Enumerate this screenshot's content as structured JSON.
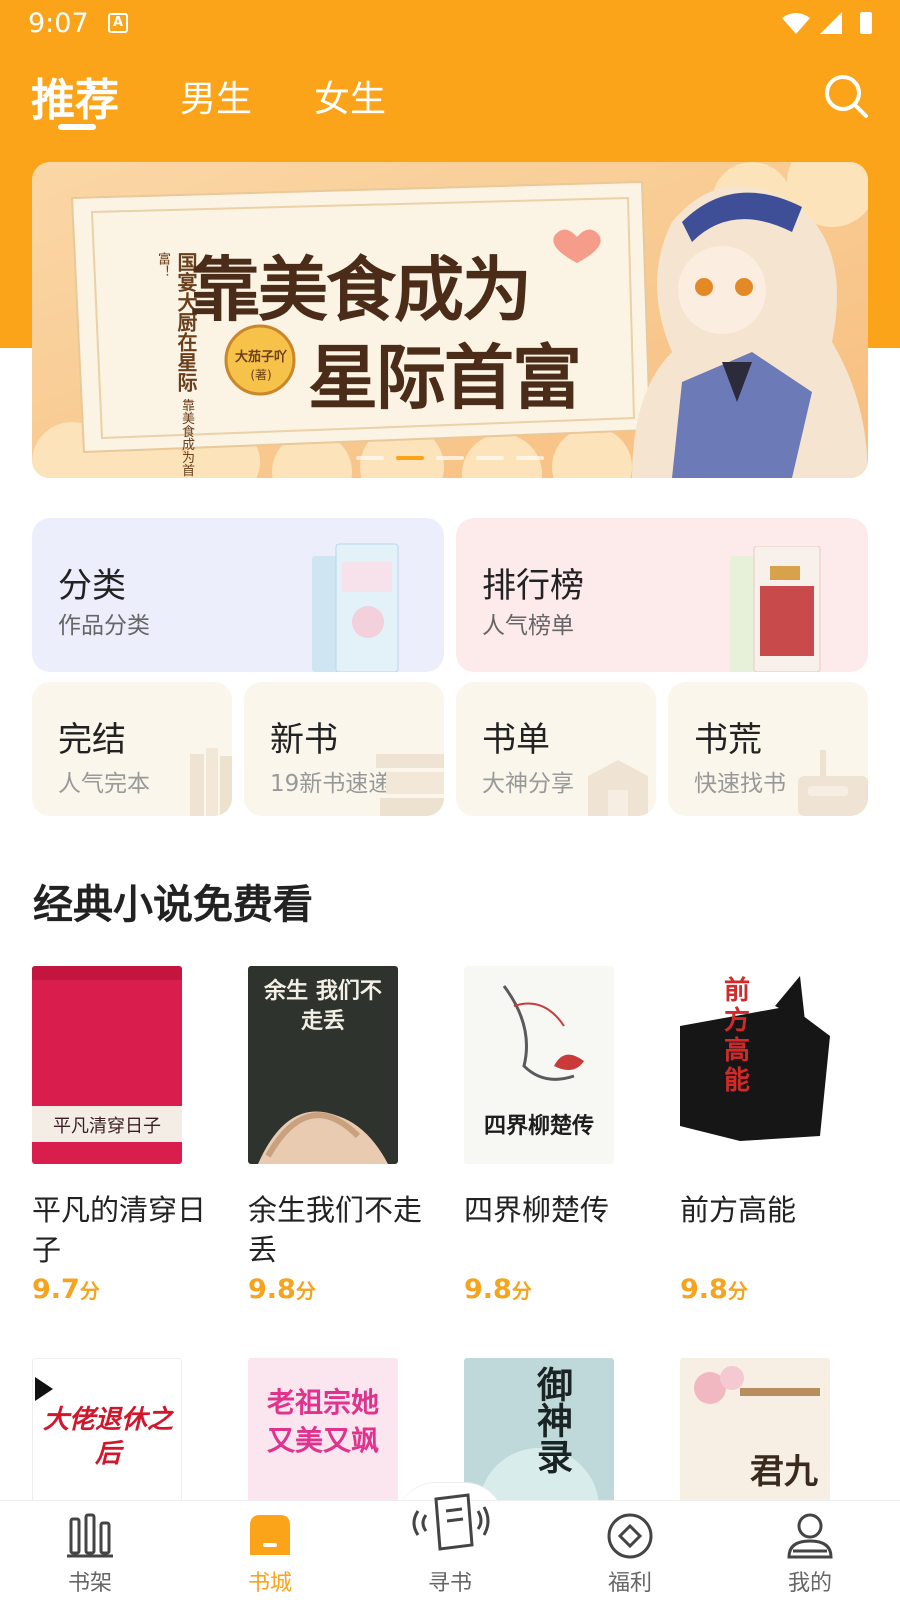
{
  "status_bar": {
    "time": "9:07",
    "notification": "A"
  },
  "top_tabs": [
    {
      "label": "推荐",
      "active": true
    },
    {
      "label": "男生",
      "active": false
    },
    {
      "label": "女生",
      "active": false
    }
  ],
  "banner": {
    "headline_line1": "靠美食成为",
    "headline_line2": "星际首富",
    "tagline_line1": "国宴大厨在星际",
    "tagline_line2": "靠美食成为首富！",
    "author": "大茄子吖",
    "author_role": "(著)",
    "slide_count": 5,
    "active_slide": 2
  },
  "feature_tiles": [
    {
      "title": "分类",
      "subtitle": "作品分类",
      "bg": "#ECEEFC"
    },
    {
      "title": "排行榜",
      "subtitle": "人气榜单",
      "bg": "#FDEAEA"
    }
  ],
  "small_tiles": [
    {
      "title": "完结",
      "subtitle": "人气完本"
    },
    {
      "title": "新书",
      "subtitle": "19新书速递"
    },
    {
      "title": "书单",
      "subtitle": "大神分享"
    },
    {
      "title": "书荒",
      "subtitle": "快速找书"
    }
  ],
  "section": {
    "title": "经典小说免费看"
  },
  "books": [
    {
      "title": "平凡的清穿日子",
      "score": "9.7",
      "unit": "分",
      "cover_text": "平凡清穿日子"
    },
    {
      "title": "余生我们不走丢",
      "score": "9.8",
      "unit": "分",
      "cover_text": "余生 我们不走丢"
    },
    {
      "title": "四界柳楚传",
      "score": "9.8",
      "unit": "分",
      "cover_text": "四界柳楚传"
    },
    {
      "title": "前方高能",
      "score": "9.8",
      "unit": "分",
      "cover_text": "前方高能"
    }
  ],
  "books_row2": [
    {
      "cover_text": "大佬退休之后"
    },
    {
      "cover_text": "老祖宗她又美又飒"
    },
    {
      "cover_text": "御神录"
    },
    {
      "cover_text": "君九"
    }
  ],
  "bottom_nav": [
    {
      "label": "书架",
      "icon": "bookshelf-icon",
      "active": false
    },
    {
      "label": "书城",
      "icon": "bookstore-icon",
      "active": true
    },
    {
      "label": "寻书",
      "icon": "find-book-icon",
      "active": false
    },
    {
      "label": "福利",
      "icon": "welfare-icon",
      "active": false
    },
    {
      "label": "我的",
      "icon": "profile-icon",
      "active": false
    }
  ],
  "colors": {
    "brand": "#FBA319",
    "score": "#F6A31E"
  }
}
